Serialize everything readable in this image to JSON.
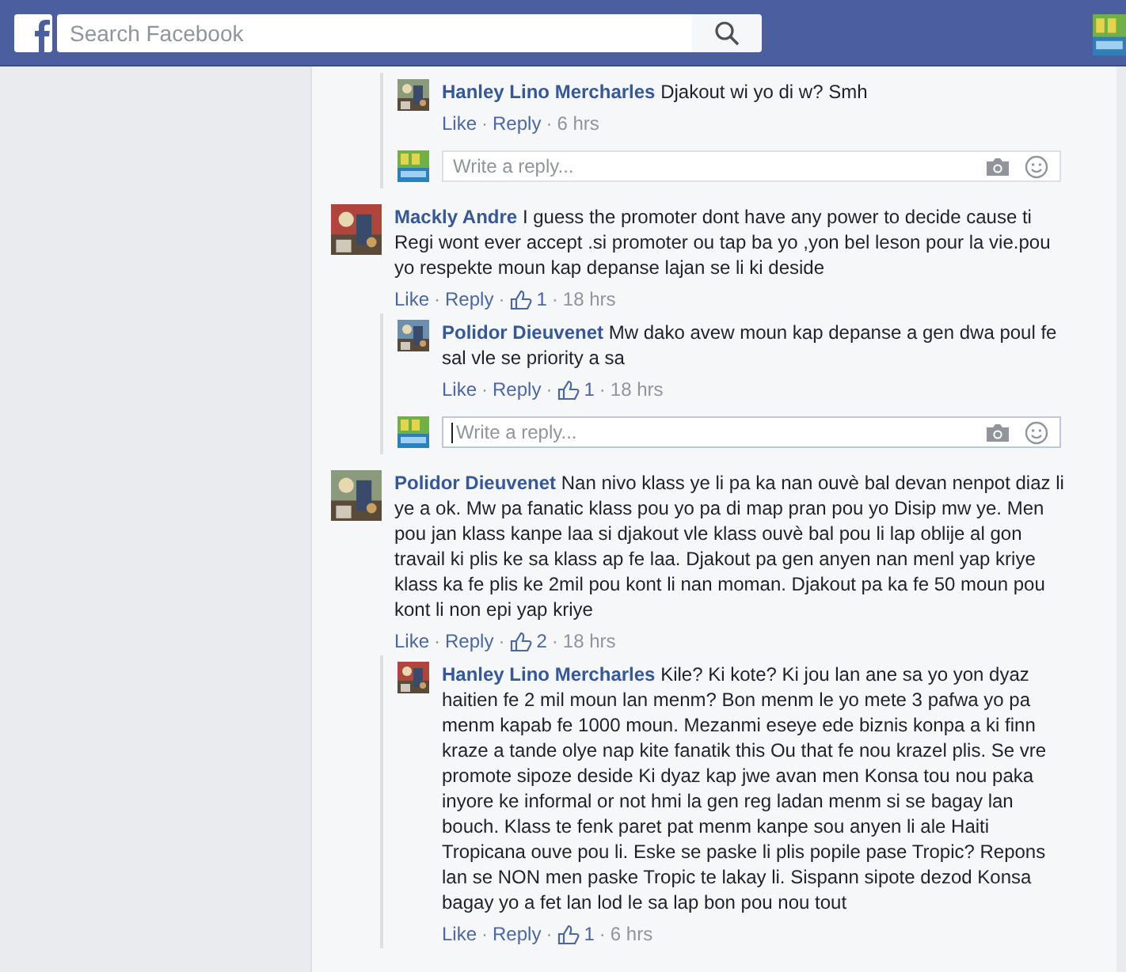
{
  "header": {
    "search_placeholder": "Search Facebook"
  },
  "separator": "·",
  "feed": [
    {
      "replies": [
        {
          "author": "Hanley Lino Mercharles",
          "text": "Djakout wi yo di w? Smh",
          "actions": [
            {
              "kind": "link",
              "text": "Like"
            },
            {
              "kind": "link",
              "text": "Reply"
            },
            {
              "kind": "time",
              "text": "6 hrs"
            }
          ]
        }
      ],
      "reply_box": {
        "placeholder": "Write a reply...",
        "focused": false
      }
    },
    {
      "comment": {
        "author": "Mackly Andre",
        "text": "I guess the promoter dont have any power to decide cause ti Regi wont ever accept .si promoter ou tap ba yo ,yon bel leson pour la vie.pou yo respekte moun kap depanse lajan se li ki deside",
        "actions": [
          {
            "kind": "link",
            "text": "Like"
          },
          {
            "kind": "link",
            "text": "Reply"
          },
          {
            "kind": "likes",
            "text": "1"
          },
          {
            "kind": "time",
            "text": "18 hrs"
          }
        ]
      },
      "replies": [
        {
          "author": "Polidor Dieuvenet",
          "text": "Mw dako avew moun kap depanse a gen dwa poul fe sal vle se priority a sa",
          "actions": [
            {
              "kind": "link",
              "text": "Like"
            },
            {
              "kind": "link",
              "text": "Reply"
            },
            {
              "kind": "likes",
              "text": "1"
            },
            {
              "kind": "time",
              "text": "18 hrs"
            }
          ]
        }
      ],
      "reply_box": {
        "placeholder": "Write a reply...",
        "focused": true
      }
    },
    {
      "comment": {
        "author": "Polidor Dieuvenet",
        "text": "Nan nivo klass ye li pa ka nan ouvè bal devan nenpot diaz li ye a ok. Mw pa fanatic klass pou yo pa di map pran pou yo Disip mw ye. Men pou jan klass kanpe laa si djakout vle klass ouvè bal pou li lap oblije al gon travail ki plis ke sa klass ap fe laa. Djakout pa gen anyen nan menl yap kriye klass ka fe plis ke 2mil pou kont li nan moman. Djakout pa ka fe 50 moun pou kont li non epi yap kriye",
        "actions": [
          {
            "kind": "link",
            "text": "Like"
          },
          {
            "kind": "link",
            "text": "Reply"
          },
          {
            "kind": "likes",
            "text": "2"
          },
          {
            "kind": "time",
            "text": "18 hrs"
          }
        ]
      },
      "replies": [
        {
          "author": "Hanley Lino Mercharles",
          "text": "Kile? Ki kote? Ki jou lan ane sa yo yon dyaz haitien fe 2 mil moun lan menm? Bon menm le yo mete 3 pafwa yo pa menm kapab fe 1000 moun. Mezanmi eseye ede biznis konpa a ki finn kraze a tande olye nap kite fanatik this Ou that fe nou krazel plis. Se vre promote sipoze deside Ki dyaz kap jwe avan men Konsa tou nou paka inyore ke informal or not hmi la gen reg ladan menm si se bagay lan bouch. Klass te fenk paret pat menm kanpe sou anyen li ale Haiti Tropicana ouve pou li. Eske se paske li plis popile pase Tropic? Repons lan se NON men paske Tropic te lakay li. Sispann sipote dezod Konsa bagay yo a fet lan lod le sa lap bon pou nou tout",
          "actions": [
            {
              "kind": "link",
              "text": "Like"
            },
            {
              "kind": "link",
              "text": "Reply"
            },
            {
              "kind": "likes",
              "text": "1"
            },
            {
              "kind": "time",
              "text": "6 hrs"
            }
          ]
        }
      ]
    }
  ]
}
